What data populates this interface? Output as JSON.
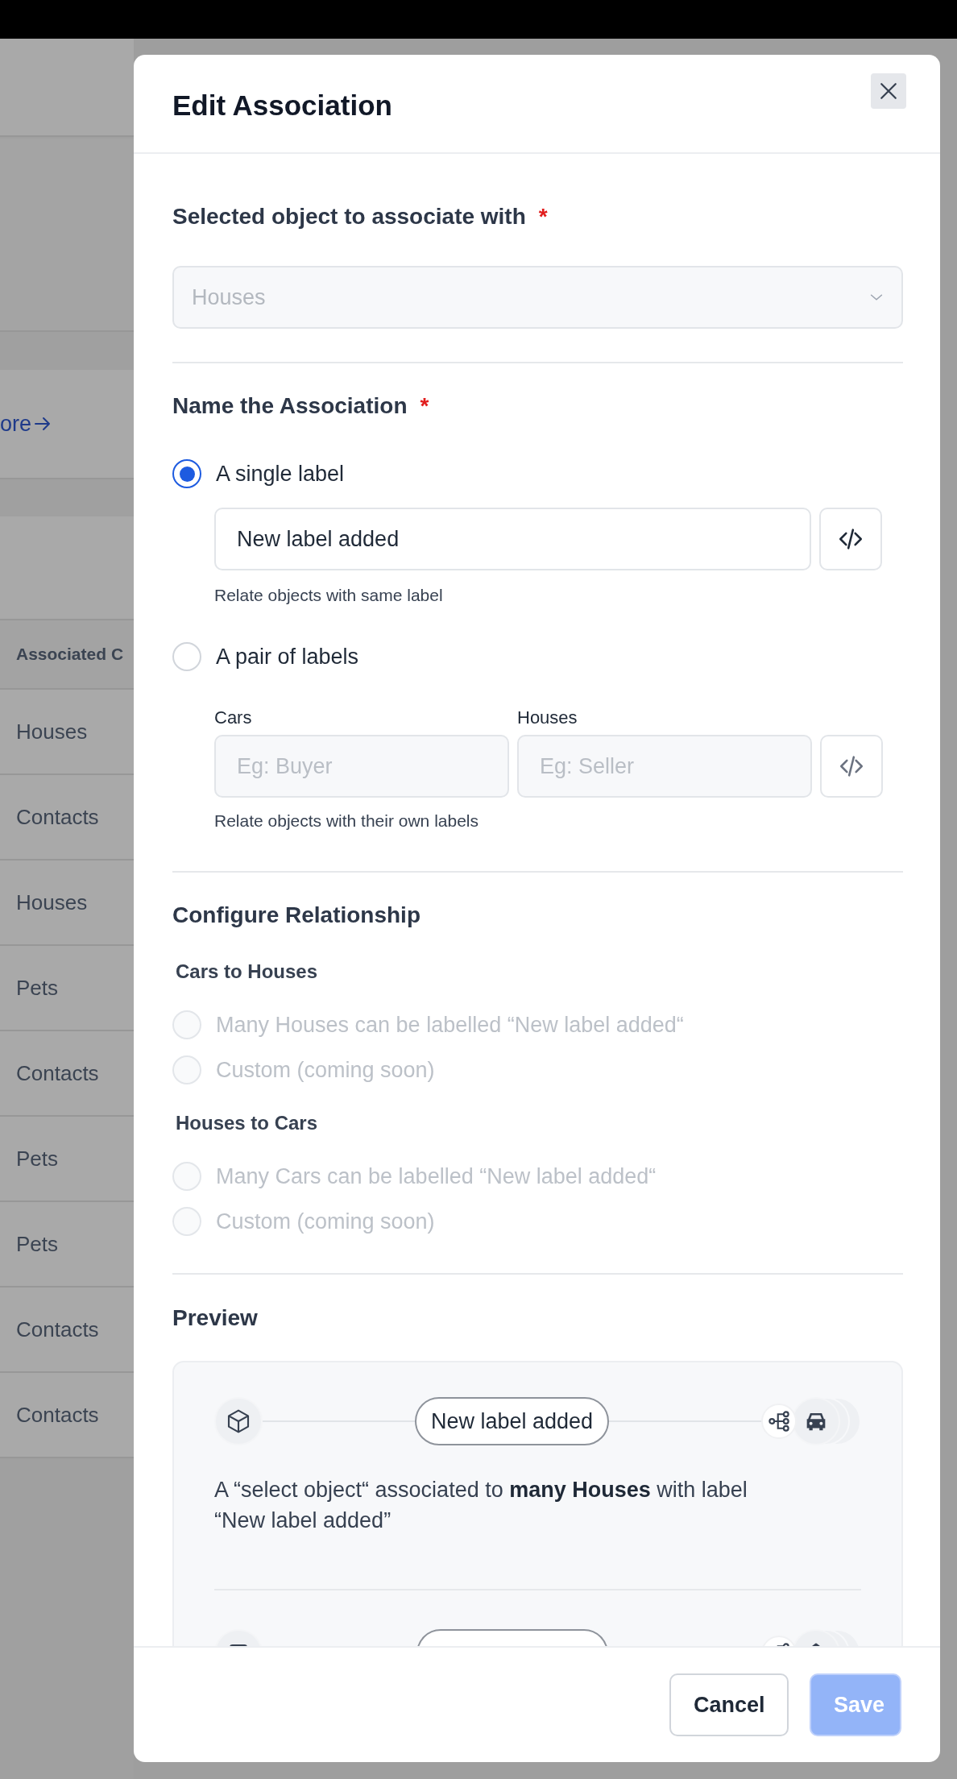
{
  "background": {
    "link": "ore",
    "table": {
      "column_1": "Associated C",
      "rows": [
        "Houses",
        "Contacts",
        "Houses",
        "Pets",
        "Contacts",
        "Pets",
        "Pets",
        "Contacts",
        "Contacts"
      ]
    }
  },
  "dialog": {
    "title": "Edit Association",
    "object_section": {
      "heading": "Selected object to associate with",
      "required_mark": "*",
      "select": {
        "value": "Houses",
        "disabled": true
      }
    },
    "name_section": {
      "heading": "Name the Association",
      "required_mark": "*",
      "options": [
        {
          "label": "A single label",
          "selected": true,
          "fields": [
            {
              "value": "New label added"
            }
          ],
          "hint": "Relate objects with same label"
        },
        {
          "label": "A pair of labels",
          "selected": false,
          "fields": [
            {
              "label": "Cars",
              "placeholder": "Eg: Buyer"
            },
            {
              "label": "Houses",
              "placeholder": "Eg: Seller"
            }
          ],
          "hint": "Relate objects with their own labels"
        }
      ]
    },
    "relationship_section": {
      "heading": "Configure Relationship",
      "groups": [
        {
          "title": "Cars to Houses",
          "options": [
            {
              "label": "Many Houses can be labelled “New label added“",
              "selected": false,
              "disabled": true
            },
            {
              "label": "Custom (coming soon)",
              "selected": false,
              "disabled": true
            }
          ]
        },
        {
          "title": "Houses to Cars",
          "options": [
            {
              "label": "Many Cars can be labelled “New label added“",
              "selected": false,
              "disabled": true
            },
            {
              "label": "Custom (coming soon)",
              "selected": false,
              "disabled": true
            }
          ]
        }
      ]
    },
    "preview": {
      "heading": "Preview",
      "rows": [
        {
          "kind": "full",
          "label": "New label added",
          "description": "A “select object“ associated to **many Houses** with label “New label added”"
        },
        {
          "kind": "cut"
        }
      ]
    },
    "buttons": [
      {
        "label": "Cancel",
        "kind": "secondary"
      },
      {
        "label": "Save",
        "kind": "primary",
        "disabled": true
      }
    ]
  }
}
